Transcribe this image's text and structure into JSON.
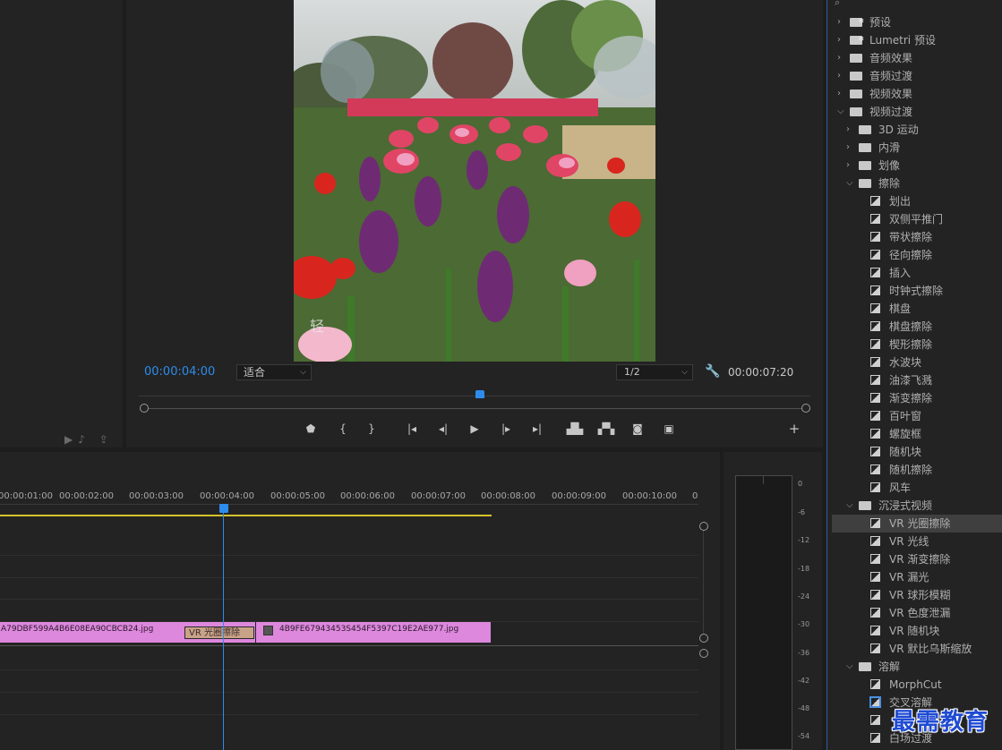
{
  "program_monitor": {
    "current_timecode": "00:00:04:00",
    "fit_value": "适合",
    "resolution_value": "1/2",
    "duration_timecode": "00:00:07:20",
    "overlay_text": "轻"
  },
  "timeline": {
    "ruler_labels": [
      "00:00:01:00",
      "00:00:02:00",
      "00:00:03:00",
      "00:00:04:00",
      "00:00:05:00",
      "00:00:06:00",
      "00:00:07:00",
      "00:00:08:00",
      "00:00:09:00",
      "00:00:10:00",
      "0"
    ],
    "clip_a_name": "A79DBF599A4B6E08EA90CBCB24.jpg",
    "clip_b_name": "4B9FE67943453S454F5397C19E2AE977.jpg",
    "transition_name": "VR 光圈擦除"
  },
  "audio_meter": {
    "db_labels": [
      "0",
      "-6",
      "-12",
      "-18",
      "-24",
      "-30",
      "-36",
      "-42",
      "-48",
      "-54"
    ]
  },
  "effects": {
    "items": [
      {
        "label": "预设",
        "type": "folder-star",
        "indent": 0,
        "state": "collapsed"
      },
      {
        "label": "Lumetri 预设",
        "type": "folder-star",
        "indent": 0,
        "state": "collapsed"
      },
      {
        "label": "音频效果",
        "type": "folder",
        "indent": 0,
        "state": "collapsed"
      },
      {
        "label": "音频过渡",
        "type": "folder",
        "indent": 0,
        "state": "collapsed"
      },
      {
        "label": "视频效果",
        "type": "folder",
        "indent": 0,
        "state": "collapsed"
      },
      {
        "label": "视频过渡",
        "type": "folder",
        "indent": 0,
        "state": "expanded"
      },
      {
        "label": "3D 运动",
        "type": "folder",
        "indent": 1,
        "state": "collapsed"
      },
      {
        "label": "内滑",
        "type": "folder",
        "indent": 1,
        "state": "collapsed"
      },
      {
        "label": "划像",
        "type": "folder",
        "indent": 1,
        "state": "collapsed"
      },
      {
        "label": "擦除",
        "type": "folder",
        "indent": 1,
        "state": "expanded"
      },
      {
        "label": "划出",
        "type": "effect",
        "indent": 2
      },
      {
        "label": "双侧平推门",
        "type": "effect",
        "indent": 2
      },
      {
        "label": "带状擦除",
        "type": "effect",
        "indent": 2
      },
      {
        "label": "径向擦除",
        "type": "effect",
        "indent": 2
      },
      {
        "label": "插入",
        "type": "effect",
        "indent": 2
      },
      {
        "label": "时钟式擦除",
        "type": "effect",
        "indent": 2
      },
      {
        "label": "棋盘",
        "type": "effect",
        "indent": 2
      },
      {
        "label": "棋盘擦除",
        "type": "effect",
        "indent": 2
      },
      {
        "label": "楔形擦除",
        "type": "effect",
        "indent": 2
      },
      {
        "label": "水波块",
        "type": "effect",
        "indent": 2
      },
      {
        "label": "油漆飞溅",
        "type": "effect",
        "indent": 2
      },
      {
        "label": "渐变擦除",
        "type": "effect",
        "indent": 2
      },
      {
        "label": "百叶窗",
        "type": "effect",
        "indent": 2
      },
      {
        "label": "螺旋框",
        "type": "effect",
        "indent": 2
      },
      {
        "label": "随机块",
        "type": "effect",
        "indent": 2
      },
      {
        "label": "随机擦除",
        "type": "effect",
        "indent": 2
      },
      {
        "label": "风车",
        "type": "effect",
        "indent": 2
      },
      {
        "label": "沉浸式视频",
        "type": "folder",
        "indent": 1,
        "state": "expanded"
      },
      {
        "label": "VR 光圈擦除",
        "type": "effect",
        "indent": 2,
        "selected": true
      },
      {
        "label": "VR 光线",
        "type": "effect",
        "indent": 2
      },
      {
        "label": "VR 渐变擦除",
        "type": "effect",
        "indent": 2
      },
      {
        "label": "VR 漏光",
        "type": "effect",
        "indent": 2
      },
      {
        "label": "VR 球形模糊",
        "type": "effect",
        "indent": 2
      },
      {
        "label": "VR 色度泄漏",
        "type": "effect",
        "indent": 2
      },
      {
        "label": "VR 随机块",
        "type": "effect",
        "indent": 2
      },
      {
        "label": "VR 默比乌斯缩放",
        "type": "effect",
        "indent": 2
      },
      {
        "label": "溶解",
        "type": "folder",
        "indent": 1,
        "state": "expanded"
      },
      {
        "label": "MorphCut",
        "type": "effect",
        "indent": 2
      },
      {
        "label": "交叉溶解",
        "type": "effect",
        "indent": 2,
        "highlight": true
      },
      {
        "label": "",
        "type": "effect",
        "indent": 2
      },
      {
        "label": "白场过渡",
        "type": "effect",
        "indent": 2
      }
    ]
  },
  "watermark": "最需教育",
  "colors": {
    "accent": "#2d8ceb",
    "clip": "#dd87dd",
    "workarea": "#d7c32b"
  }
}
